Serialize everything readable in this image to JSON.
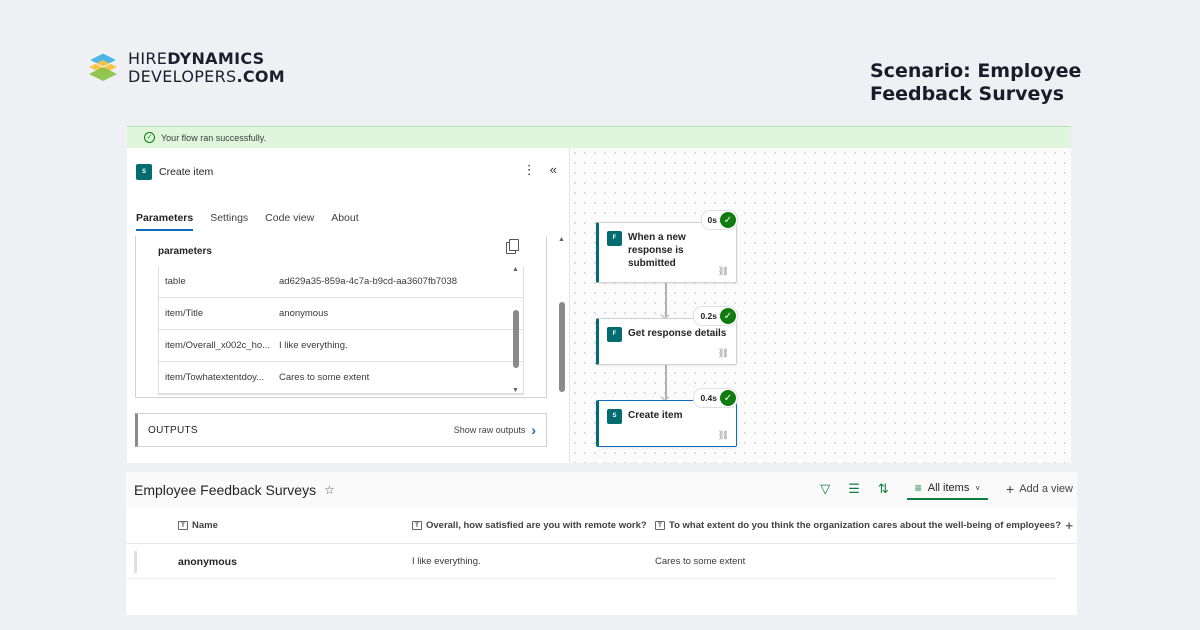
{
  "brand": {
    "line1_a": "HIRE",
    "line1_b": "DYNAMICS",
    "line2_a": "DEVELOPERS",
    "line2_b": ".COM"
  },
  "scenario": "Scenario: Employee Feedback Surveys",
  "flow": {
    "banner": "Your flow ran successfully.",
    "panel": {
      "title": "Create item",
      "icon_label": "S",
      "tabs": [
        "Parameters",
        "Settings",
        "Code view",
        "About"
      ],
      "active_tab": "Parameters",
      "params_title": "parameters",
      "rows": [
        {
          "key": "table",
          "value": "ad629a35-859a-4c7a-b9cd-aa3607fb7038"
        },
        {
          "key": "item/Title",
          "value": "anonymous"
        },
        {
          "key": "item/Overall_x002c_ho...",
          "value": "I like everything."
        },
        {
          "key": "item/Towhatextentdoy...",
          "value": "Cares to some extent"
        }
      ],
      "outputs_title": "OUTPUTS",
      "show_raw": "Show raw outputs"
    },
    "nodes": [
      {
        "title": "When a new response is submitted",
        "duration": "0s"
      },
      {
        "title": "Get response details",
        "duration": "0.2s"
      },
      {
        "title": "Create item",
        "duration": "0.4s"
      }
    ]
  },
  "list": {
    "title": "Employee Feedback Surveys",
    "view": "All items",
    "add_view": "Add a view",
    "columns": [
      "Name",
      "Overall, how satisfied are you with remote work?",
      "To what extent do you think the organization cares about the well-being of employees?"
    ],
    "rows": [
      {
        "name": "anonymous",
        "q1": "I like everything.",
        "q2": "Cares to some extent"
      }
    ]
  },
  "icons": {
    "success": "check-circle-icon",
    "sharepoint": "sharepoint-icon",
    "more": "more-vertical-icon",
    "collapse": "double-chevron-left-icon"
  },
  "colors": {
    "success": "#107c10",
    "accent": "#0f6cbd",
    "sharepoint": "#036c70",
    "list_accent": "#107c41"
  }
}
